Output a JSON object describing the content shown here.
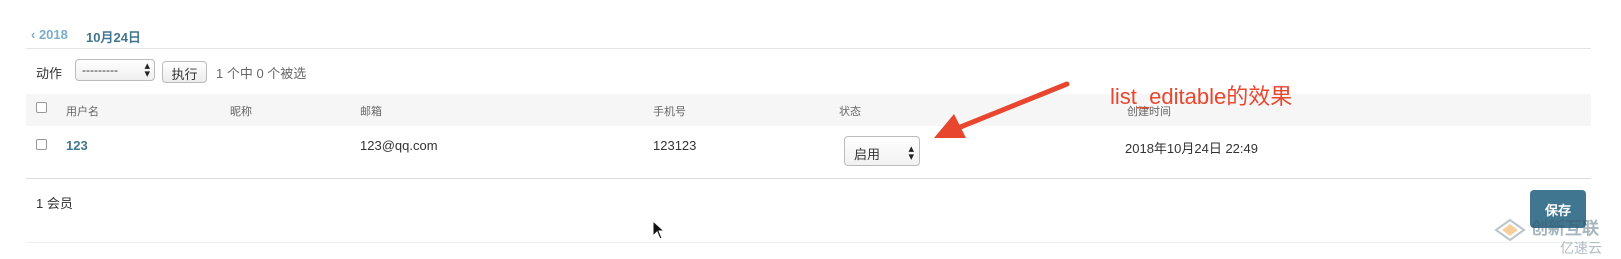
{
  "date_hierarchy": {
    "back": "‹ 2018",
    "current": "10月24日"
  },
  "actions": {
    "label": "动作",
    "select_value": "---------",
    "go_label": "执行",
    "selected_count": "1 个中 0 个被选"
  },
  "table": {
    "headers": [
      "用户名",
      "昵称",
      "邮箱",
      "手机号",
      "状态",
      "创建时间"
    ],
    "rows": [
      {
        "username": "123",
        "nickname": "",
        "email": "123@qq.com",
        "phone": "123123",
        "status": "启用",
        "created": "2018年10月24日 22:49"
      }
    ]
  },
  "annotation": {
    "text": "list_editable的效果",
    "color": "#e8462f"
  },
  "footer": {
    "result_count": "1 会员",
    "save_label": "保存"
  },
  "watermark": {
    "text_cn": "创新互联",
    "text_cloud": "亿速云"
  },
  "colors": {
    "link": "#417690",
    "save_button": "#417690",
    "header_bg": "#f6f6f6"
  }
}
